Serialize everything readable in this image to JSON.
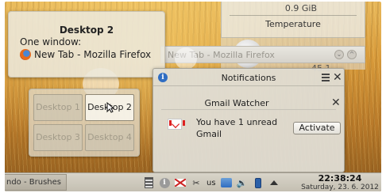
{
  "background_widget": {
    "size_text": "0.9 GiB",
    "temperature_label": "Temperature",
    "gauge_value": "45.1"
  },
  "firefox_window": {
    "title": "New Tab - Mozilla Firefox"
  },
  "desktop_tooltip": {
    "title": "Desktop 2",
    "subtitle": "One window:",
    "window_title": "New Tab - Mozilla Firefox"
  },
  "pager": {
    "desktops": [
      "Desktop 1",
      "Desktop 2",
      "Desktop 3",
      "Desktop 4"
    ],
    "active_index": 1
  },
  "notifications": {
    "title": "Notifications",
    "app_name": "Gmail Watcher",
    "message_line1": "You have 1 unread",
    "message_line2": "Gmail",
    "action_label": "Activate"
  },
  "taskbar": {
    "task_label": "ndo - Brushes",
    "keyboard_layout": "us",
    "time": "22:38:24",
    "date": "Saturday, 23. 6. 2012"
  },
  "colors": {
    "accent": "#2f6dc2",
    "gmail_red": "#dd2222"
  }
}
